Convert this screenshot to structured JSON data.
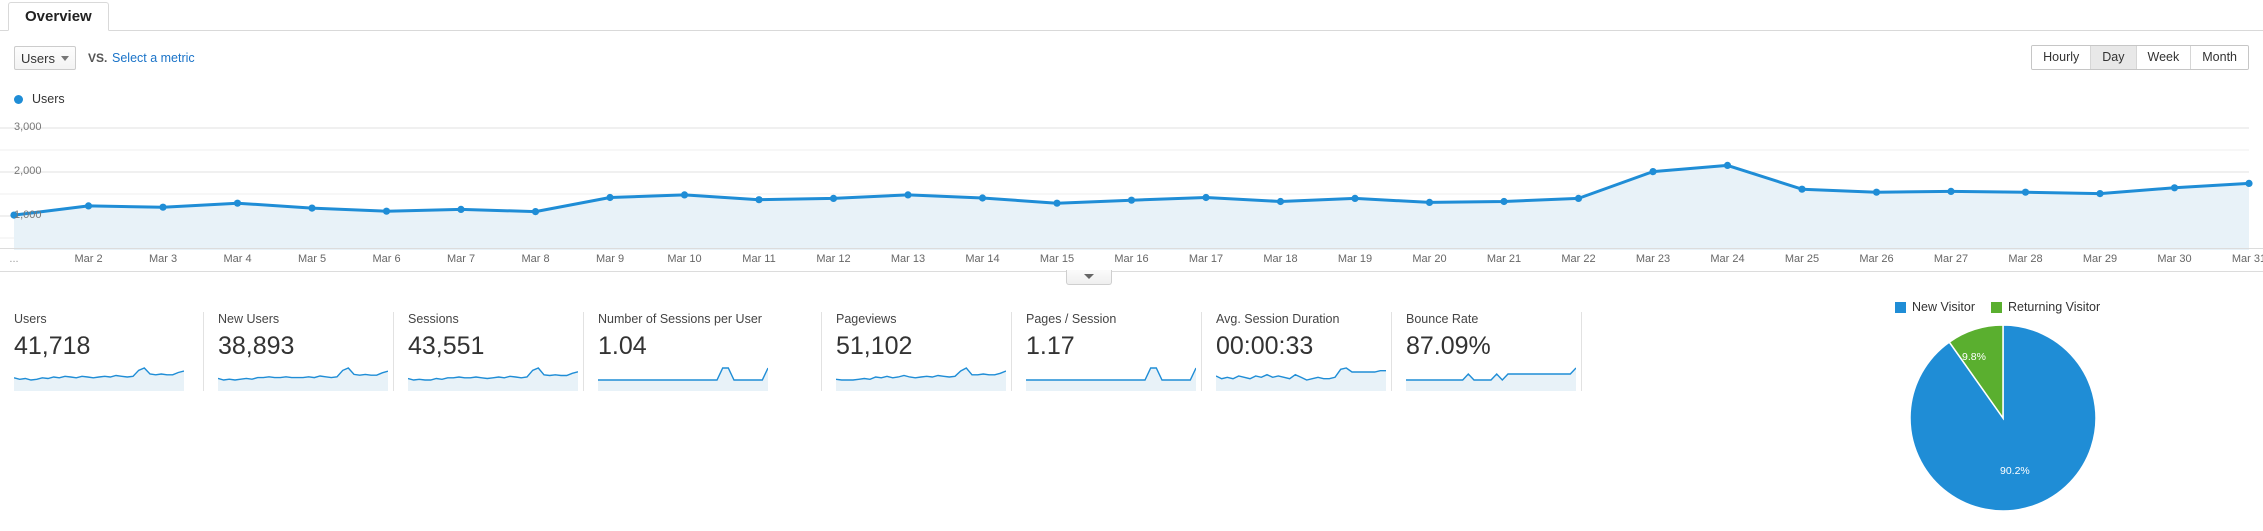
{
  "tabs": [
    {
      "label": "Overview",
      "selected": true
    }
  ],
  "controls": {
    "metric_select_value": "Users",
    "metric_select_icon": "chevron-down-icon",
    "vs_label": "VS.",
    "select_metric_link": "Select a metric",
    "granularity": [
      {
        "label": "Hourly",
        "selected": false
      },
      {
        "label": "Day",
        "selected": true
      },
      {
        "label": "Week",
        "selected": false
      },
      {
        "label": "Month",
        "selected": false
      }
    ]
  },
  "chart_legend": {
    "series_name": "Users",
    "color": "#1f8dd6"
  },
  "chart_data": {
    "type": "line",
    "title": "Users",
    "xlabel": "",
    "ylabel": "Users",
    "ylim": [
      0,
      3000
    ],
    "yticks": [
      1000,
      2000,
      3000
    ],
    "ytick_labels": [
      "1,000",
      "2,000",
      "3,000"
    ],
    "grid": true,
    "legend_position": "top-left",
    "area_fill": "#e8f2f8",
    "line_color": "#1f8dd6",
    "categories": [
      "...",
      "Mar 2",
      "Mar 3",
      "Mar 4",
      "Mar 5",
      "Mar 6",
      "Mar 7",
      "Mar 8",
      "Mar 9",
      "Mar 10",
      "Mar 11",
      "Mar 12",
      "Mar 13",
      "Mar 14",
      "Mar 15",
      "Mar 16",
      "Mar 17",
      "Mar 18",
      "Mar 19",
      "Mar 20",
      "Mar 21",
      "Mar 22",
      "Mar 23",
      "Mar 24",
      "Mar 25",
      "Mar 26",
      "Mar 27",
      "Mar 28",
      "Mar 29",
      "Mar 30",
      "Mar 31"
    ],
    "values": [
      1020,
      1230,
      1200,
      1290,
      1180,
      1110,
      1150,
      1100,
      1420,
      1480,
      1370,
      1400,
      1480,
      1410,
      1290,
      1360,
      1420,
      1330,
      1400,
      1310,
      1330,
      1400,
      2010,
      2150,
      1610,
      1540,
      1560,
      1540,
      1510,
      1640,
      1740
    ]
  },
  "cards": [
    {
      "label": "Users",
      "value": "41,718",
      "sparkline": [
        12,
        10,
        11,
        9,
        10,
        12,
        11,
        13,
        12,
        14,
        13,
        12,
        14,
        13,
        12,
        13,
        14,
        13,
        15,
        14,
        13,
        14,
        22,
        25,
        17,
        16,
        17,
        16,
        16,
        19,
        21
      ]
    },
    {
      "label": "New Users",
      "value": "38,893",
      "sparkline": [
        11,
        9,
        10,
        9,
        10,
        11,
        10,
        12,
        12,
        13,
        12,
        12,
        13,
        12,
        12,
        12,
        13,
        12,
        14,
        13,
        12,
        13,
        21,
        24,
        16,
        15,
        16,
        15,
        15,
        18,
        20
      ]
    },
    {
      "label": "Sessions",
      "value": "43,551",
      "sparkline": [
        12,
        10,
        11,
        10,
        10,
        12,
        11,
        13,
        13,
        14,
        13,
        13,
        14,
        13,
        12,
        13,
        14,
        13,
        15,
        14,
        13,
        14,
        23,
        26,
        17,
        16,
        17,
        16,
        16,
        19,
        21
      ]
    },
    {
      "label": "Number of Sessions per User",
      "value": "1.04",
      "sparkline": [
        10,
        10,
        10,
        10,
        10,
        10,
        10,
        10,
        10,
        10,
        10,
        10,
        10,
        10,
        10,
        10,
        10,
        10,
        10,
        10,
        10,
        10,
        11,
        11,
        10,
        10,
        10,
        10,
        10,
        10,
        11
      ]
    },
    {
      "label": "Pageviews",
      "value": "51,102",
      "sparkline": [
        11,
        10,
        10,
        10,
        11,
        12,
        11,
        14,
        13,
        15,
        13,
        14,
        16,
        14,
        13,
        14,
        15,
        14,
        16,
        15,
        14,
        15,
        22,
        26,
        17,
        17,
        18,
        17,
        17,
        19,
        22
      ]
    },
    {
      "label": "Pages / Session",
      "value": "1.17",
      "sparkline": [
        12,
        12,
        12,
        12,
        12,
        12,
        12,
        12,
        12,
        12,
        12,
        12,
        12,
        12,
        12,
        12,
        12,
        12,
        12,
        12,
        12,
        12,
        13,
        13,
        12,
        12,
        12,
        12,
        12,
        12,
        13
      ]
    },
    {
      "label": "Avg. Session Duration",
      "value": "00:00:33",
      "sparkline": [
        13,
        11,
        12,
        11,
        13,
        12,
        11,
        13,
        12,
        14,
        12,
        13,
        12,
        11,
        14,
        12,
        10,
        11,
        12,
        11,
        11,
        12,
        18,
        19,
        16,
        16,
        16,
        16,
        16,
        17,
        17
      ]
    },
    {
      "label": "Bounce Rate",
      "value": "87.09%",
      "sparkline": [
        14,
        14,
        14,
        14,
        14,
        14,
        14,
        14,
        14,
        14,
        14,
        15,
        14,
        14,
        14,
        14,
        15,
        14,
        15,
        15,
        15,
        15,
        15,
        15,
        15,
        15,
        15,
        15,
        15,
        15,
        16
      ]
    }
  ],
  "pie": {
    "legend": [
      {
        "label": "New Visitor",
        "color": "#1f8dd6"
      },
      {
        "label": "Returning Visitor",
        "color": "#5aaf2f"
      }
    ],
    "chart_data": {
      "type": "pie",
      "title": "",
      "labels": [
        "New Visitor",
        "Returning Visitor"
      ],
      "values": [
        90.2,
        9.8
      ],
      "value_labels": [
        "90.2%",
        "9.8%"
      ],
      "colors": [
        "#1f8dd6",
        "#5aaf2f"
      ]
    }
  }
}
